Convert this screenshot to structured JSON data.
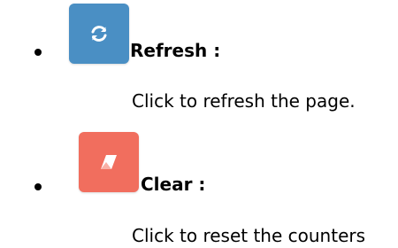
{
  "items": [
    {
      "icon": "refresh-icon",
      "title": "Refresh :",
      "description": "Click to refresh the page.",
      "color": "#4a8fc4"
    },
    {
      "icon": "eraser-icon",
      "title": "Clear :",
      "description": "Click to reset the counters",
      "color": "#f16e5e"
    }
  ]
}
